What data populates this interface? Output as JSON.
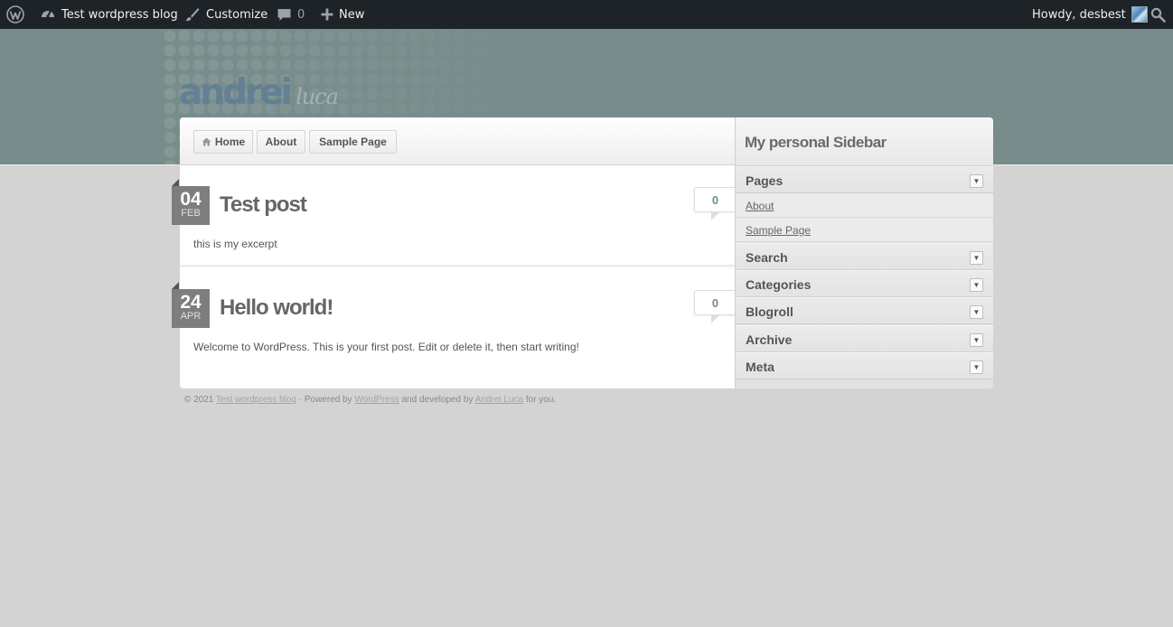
{
  "adminbar": {
    "site_name": "Test wordpress blog",
    "customize": "Customize",
    "comments_count": "0",
    "new_label": "New",
    "howdy": "Howdy, desbest",
    "bg_color": "#1d2327"
  },
  "header": {
    "logo_main": "andrei",
    "logo_sub": "luca",
    "bg_color": "#778c8b"
  },
  "nav": {
    "items": [
      "Home",
      "About",
      "Sample Page"
    ]
  },
  "posts": [
    {
      "day": "04",
      "month": "FEB",
      "title": "Test post",
      "comments": "0",
      "excerpt": "this is my excerpt"
    },
    {
      "day": "24",
      "month": "APR",
      "title": "Hello world!",
      "comments": "0",
      "excerpt": "Welcome to WordPress. This is your first post. Edit or delete it, then start writing!"
    }
  ],
  "sidebar": {
    "title": "My personal Sidebar",
    "widgets": [
      "Pages",
      "Search",
      "Categories",
      "Blogroll",
      "Archive",
      "Meta"
    ],
    "pages_links": [
      "About",
      "Sample Page"
    ]
  },
  "footer": {
    "copyright": "© 2021",
    "site_link": "Test wordpress blog",
    "powered_by": "· Powered by",
    "wp_link": "WordPress",
    "developed_by": "and developed by",
    "author_link": "Andrei Luca",
    "for_you": "for you."
  }
}
